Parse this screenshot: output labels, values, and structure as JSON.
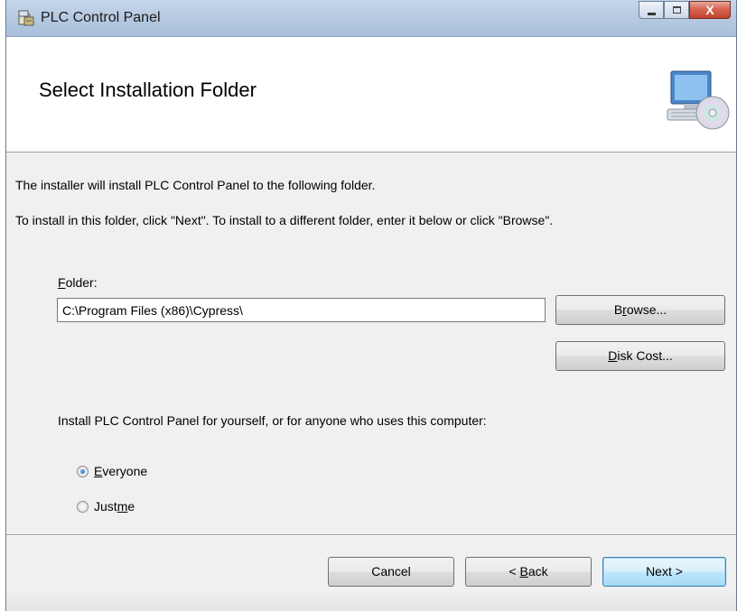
{
  "window": {
    "title": "PLC Control Panel",
    "close_glyph": "X"
  },
  "header": {
    "title": "Select Installation Folder",
    "icon": "computer-cd-icon"
  },
  "body": {
    "intro": "The installer will install PLC Control Panel to the following folder.",
    "instructions": "To install in this folder, click \"Next\". To install to a different folder, enter it below or click \"Browse\".",
    "folder_label_mnemonic": "F",
    "folder_label_rest": "older:",
    "folder_value": "C:\\Program Files (x86)\\Cypress\\",
    "browse_pre": "B",
    "browse_mnemonic": "r",
    "browse_post": "owse...",
    "diskcost_mnemonic": "D",
    "diskcost_post": "isk Cost...",
    "install_for": "Install PLC Control Panel for yourself, or for anyone who uses this computer:",
    "everyone_mnemonic": "E",
    "everyone_rest": "veryone",
    "justme_pre": "Just ",
    "justme_mnemonic": "m",
    "justme_post": "e",
    "selected_option": "Everyone"
  },
  "footer": {
    "cancel": "Cancel",
    "back_pre": "< ",
    "back_mnemonic": "B",
    "back_post": "ack",
    "next": "Next >"
  },
  "colors": {
    "titlebar": "#b7cbe2",
    "dialog_bg": "#f0f0f0",
    "default_button_border": "#3c7fb1"
  }
}
